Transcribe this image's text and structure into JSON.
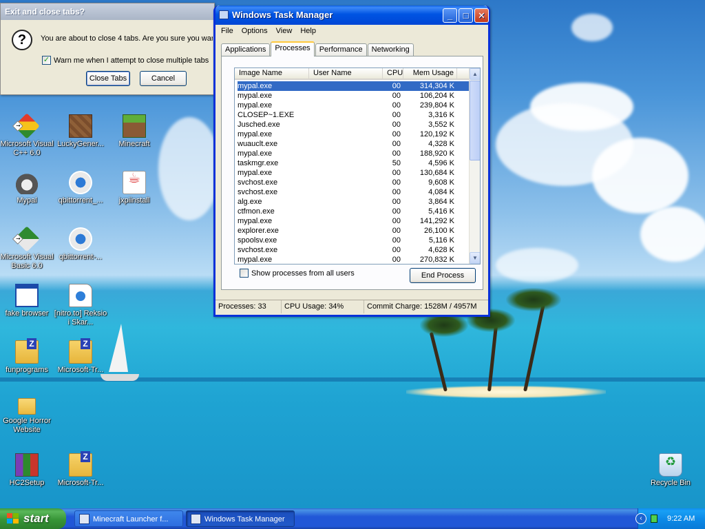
{
  "desktop": {
    "icons": [
      {
        "label": "Microsoft Visual C++ 6.0",
        "icon": "visual-cpp-icon"
      },
      {
        "label": "LuckyGener...",
        "icon": "minecraft-dirt-icon"
      },
      {
        "label": "Minecraft",
        "icon": "minecraft-grass-icon"
      },
      {
        "label": "Mypal",
        "icon": "mypal-raccoon-icon"
      },
      {
        "label": "qbittorrent_...",
        "icon": "installer-disc-icon"
      },
      {
        "label": "jxpiinstall",
        "icon": "java-icon"
      },
      {
        "label": "Microsoft Visual Basic 6.0",
        "icon": "visual-basic-icon"
      },
      {
        "label": "qbittorrent-...",
        "icon": "installer-disc-icon"
      },
      {
        "label": "fake browser",
        "icon": "window-icon"
      },
      {
        "label": "[nitro.to] Reksio i Skar...",
        "icon": "document-icon"
      },
      {
        "label": "funprograms",
        "icon": "zip-folder-icon"
      },
      {
        "label": "Microsoft-Tr...",
        "icon": "zip-folder-icon"
      },
      {
        "label": "Google Horror Website",
        "icon": "folder-icon"
      },
      {
        "label": "HC2Setup",
        "icon": "winrar-icon"
      },
      {
        "label": "Microsoft-Tr...",
        "icon": "zip-folder-icon"
      },
      {
        "label": "Recycle Bin",
        "icon": "recycle-bin-icon"
      }
    ]
  },
  "dialog": {
    "title": "Exit and close tabs?",
    "message": "You are about to close 4 tabs. Are you sure you war",
    "checkbox_label": "Warn me when I attempt to close multiple tabs",
    "checkbox_checked": true,
    "close_tabs_label": "Close Tabs",
    "cancel_label": "Cancel"
  },
  "taskmgr": {
    "title": "Windows Task Manager",
    "menu": [
      "File",
      "Options",
      "View",
      "Help"
    ],
    "tabs": [
      {
        "label": "Applications",
        "active": false
      },
      {
        "label": "Processes",
        "active": true
      },
      {
        "label": "Performance",
        "active": false
      },
      {
        "label": "Networking",
        "active": false
      }
    ],
    "columns": {
      "image": "Image Name",
      "user": "User Name",
      "cpu": "CPU",
      "mem": "Mem Usage"
    },
    "processes": [
      {
        "image": "mypal.exe",
        "user": "",
        "cpu": "00",
        "mem": "314,304 K",
        "selected": true
      },
      {
        "image": "mypal.exe",
        "user": "",
        "cpu": "00",
        "mem": "106,204 K"
      },
      {
        "image": "mypal.exe",
        "user": "",
        "cpu": "00",
        "mem": "239,804 K"
      },
      {
        "image": "CLOSEP~1.EXE",
        "user": "",
        "cpu": "00",
        "mem": "3,316 K"
      },
      {
        "image": "Jusched.exe",
        "user": "",
        "cpu": "00",
        "mem": "3,552 K"
      },
      {
        "image": "mypal.exe",
        "user": "",
        "cpu": "00",
        "mem": "120,192 K"
      },
      {
        "image": "wuauclt.exe",
        "user": "",
        "cpu": "00",
        "mem": "4,328 K"
      },
      {
        "image": "mypal.exe",
        "user": "",
        "cpu": "00",
        "mem": "188,920 K"
      },
      {
        "image": "taskmgr.exe",
        "user": "",
        "cpu": "50",
        "mem": "4,596 K"
      },
      {
        "image": "mypal.exe",
        "user": "",
        "cpu": "00",
        "mem": "130,684 K"
      },
      {
        "image": "svchost.exe",
        "user": "",
        "cpu": "00",
        "mem": "9,608 K"
      },
      {
        "image": "svchost.exe",
        "user": "",
        "cpu": "00",
        "mem": "4,084 K"
      },
      {
        "image": "alg.exe",
        "user": "",
        "cpu": "00",
        "mem": "3,864 K"
      },
      {
        "image": "ctfmon.exe",
        "user": "",
        "cpu": "00",
        "mem": "5,416 K"
      },
      {
        "image": "mypal.exe",
        "user": "",
        "cpu": "00",
        "mem": "141,292 K"
      },
      {
        "image": "explorer.exe",
        "user": "",
        "cpu": "00",
        "mem": "26,100 K"
      },
      {
        "image": "spoolsv.exe",
        "user": "",
        "cpu": "00",
        "mem": "5,116 K"
      },
      {
        "image": "svchost.exe",
        "user": "",
        "cpu": "00",
        "mem": "4,628 K"
      },
      {
        "image": "mypal.exe",
        "user": "",
        "cpu": "00",
        "mem": "270,832 K"
      }
    ],
    "show_all_label": "Show processes from all users",
    "end_process_label": "End Process",
    "status": {
      "processes": "Processes: 33",
      "cpu": "CPU Usage: 34%",
      "commit": "Commit Charge: 1528M / 4957M"
    }
  },
  "taskbar": {
    "start_label": "start",
    "buttons": [
      {
        "label": "Minecraft Launcher f...",
        "active": false
      },
      {
        "label": "Windows Task Manager",
        "active": true
      }
    ],
    "clock": "9:22 AM"
  },
  "colors": {
    "xp_blue": "#0054e3",
    "selection": "#316ac5",
    "start_green": "#379537"
  }
}
